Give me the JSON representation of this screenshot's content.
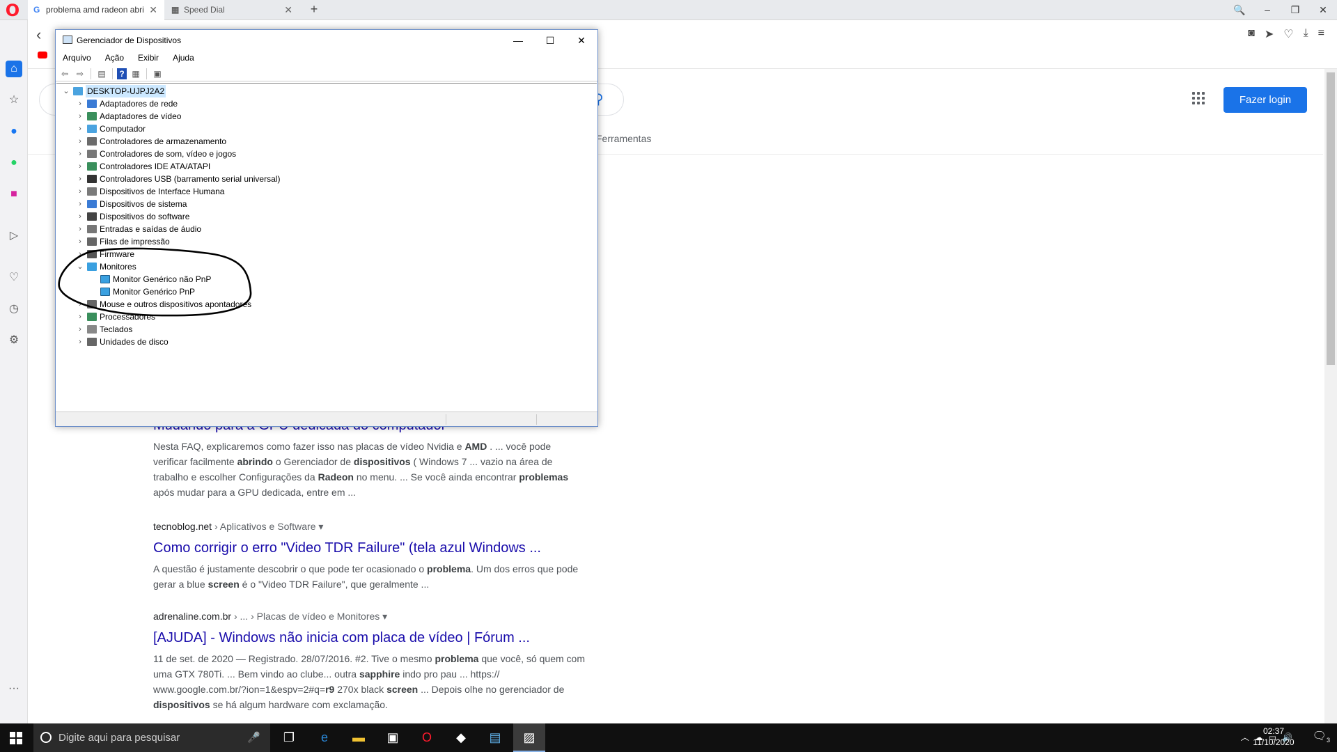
{
  "browser": {
    "tabs": [
      {
        "title": "problema amd radeon abri",
        "favicon": "G"
      },
      {
        "title": "Speed Dial",
        "favicon": "grid"
      }
    ],
    "new_tab": "+",
    "window_controls": {
      "search": "🔍",
      "minimize": "–",
      "restore": "❐",
      "close": "✕"
    },
    "sidebar_icons": [
      "home-icon",
      "star-icon",
      "messenger-icon",
      "whatsapp-icon",
      "instagram-icon",
      "send-icon",
      "heart-icon",
      "history-icon",
      "settings-icon",
      "more-icon"
    ]
  },
  "google": {
    "login_label": "Fazer login",
    "tools_label": "Ferramentas",
    "results": [
      {
        "cite": "",
        "title": "Mudando para a GPU dedicada do computador -",
        "snippet": [
          {
            "t": "Nesta FAQ, explicaremos como fazer isso nas placas de vídeo Nvidia e "
          },
          {
            "t": "AMD",
            "b": true
          },
          {
            "t": " . ... você pode verificar facilmente "
          },
          {
            "t": "abrindo",
            "b": true
          },
          {
            "t": " o Gerenciador de "
          },
          {
            "t": "dispositivos",
            "b": true
          },
          {
            "t": " ( Windows 7 ... vazio na área de trabalho e escolher Configurações da "
          },
          {
            "t": "Radeon",
            "b": true
          },
          {
            "t": " no menu. ... Se você ainda encontrar "
          },
          {
            "t": "problemas",
            "b": true
          },
          {
            "t": " após mudar para a GPU dedicada, entre em ..."
          }
        ]
      },
      {
        "cite": "tecnoblog.net",
        "cite_path": " › Aplicativos e Software ▾",
        "title": "Como corrigir o erro \"Video TDR Failure\" (tela azul Windows ...",
        "snippet": [
          {
            "t": "A questão é justamente descobrir o que pode ter ocasionado o "
          },
          {
            "t": "problema",
            "b": true
          },
          {
            "t": ". Um dos erros que pode gerar a blue "
          },
          {
            "t": "screen",
            "b": true
          },
          {
            "t": " é o \"Video TDR Failure\", que geralmente ..."
          }
        ]
      },
      {
        "cite": "adrenaline.com.br",
        "cite_path": " › ... › Placas de vídeo e Monitores ▾",
        "title": "[AJUDA] - Windows não inicia com placa de vídeo | Fórum ...",
        "snippet": [
          {
            "t": "11 de set. de 2020 — Registrado. 28/07/2016. #2. Tive o mesmo "
          },
          {
            "t": "problema",
            "b": true
          },
          {
            "t": " que você, só quem com uma GTX 780Ti. ... Bem vindo ao clube... outra "
          },
          {
            "t": "sapphire",
            "b": true
          },
          {
            "t": " indo pro pau ... https:// www.google.com.br/?ion=1&espv=2#q="
          },
          {
            "t": "r9",
            "b": true
          },
          {
            "t": " 270x black "
          },
          {
            "t": "screen",
            "b": true
          },
          {
            "t": " ... Depois olhe no gerenciador de "
          },
          {
            "t": "dispositivos",
            "b": true
          },
          {
            "t": " se há algum hardware com exclamação."
          }
        ]
      }
    ]
  },
  "device_manager": {
    "title": "Gerenciador de Dispositivos",
    "menu": [
      "Arquivo",
      "Ação",
      "Exibir",
      "Ajuda"
    ],
    "root": "DESKTOP-UJPJ2A2",
    "categories": [
      {
        "label": "Adaptadores de rede",
        "icon": "network-icon",
        "color": "#3a7bd5"
      },
      {
        "label": "Adaptadores de vídeo",
        "icon": "display-adapter-icon",
        "color": "#3a8f5c"
      },
      {
        "label": "Computador",
        "icon": "computer-icon",
        "color": "#4aa3df"
      },
      {
        "label": "Controladores de armazenamento",
        "icon": "storage-icon",
        "color": "#6b6b6b"
      },
      {
        "label": "Controladores de som, vídeo e jogos",
        "icon": "speaker-icon",
        "color": "#777777"
      },
      {
        "label": "Controladores IDE ATA/ATAPI",
        "icon": "ide-icon",
        "color": "#3a8f5c"
      },
      {
        "label": "Controladores USB (barramento serial universal)",
        "icon": "usb-icon",
        "color": "#333333"
      },
      {
        "label": "Dispositivos de Interface Humana",
        "icon": "hid-icon",
        "color": "#7a7a7a"
      },
      {
        "label": "Dispositivos de sistema",
        "icon": "system-icon",
        "color": "#3a7bd5"
      },
      {
        "label": "Dispositivos do software",
        "icon": "software-icon",
        "color": "#444444"
      },
      {
        "label": "Entradas e saídas de áudio",
        "icon": "audio-icon",
        "color": "#777777"
      },
      {
        "label": "Filas de impressão",
        "icon": "printer-icon",
        "color": "#666666"
      },
      {
        "label": "Firmware",
        "icon": "firmware-icon",
        "color": "#555555"
      },
      {
        "label": "Monitores",
        "icon": "monitor-icon",
        "color": "#3aa0e0",
        "expanded": true,
        "children": [
          "Monitor Genérico não PnP",
          "Monitor Genérico PnP"
        ]
      },
      {
        "label": "Mouse e outros dispositivos apontadores",
        "icon": "mouse-icon",
        "color": "#666666"
      },
      {
        "label": "Processadores",
        "icon": "cpu-icon",
        "color": "#3a8f5c"
      },
      {
        "label": "Teclados",
        "icon": "keyboard-icon",
        "color": "#888888"
      },
      {
        "label": "Unidades de disco",
        "icon": "disk-icon",
        "color": "#666666"
      }
    ]
  },
  "taskbar": {
    "search_placeholder": "Digite aqui para pesquisar",
    "time": "02:37",
    "date": "11/10/2020",
    "notification_count": "3",
    "apps": [
      "task-view-icon",
      "edge-icon",
      "file-explorer-icon",
      "store-icon",
      "opera-icon",
      "game-icon",
      "app-icon",
      "device-manager-icon"
    ]
  }
}
